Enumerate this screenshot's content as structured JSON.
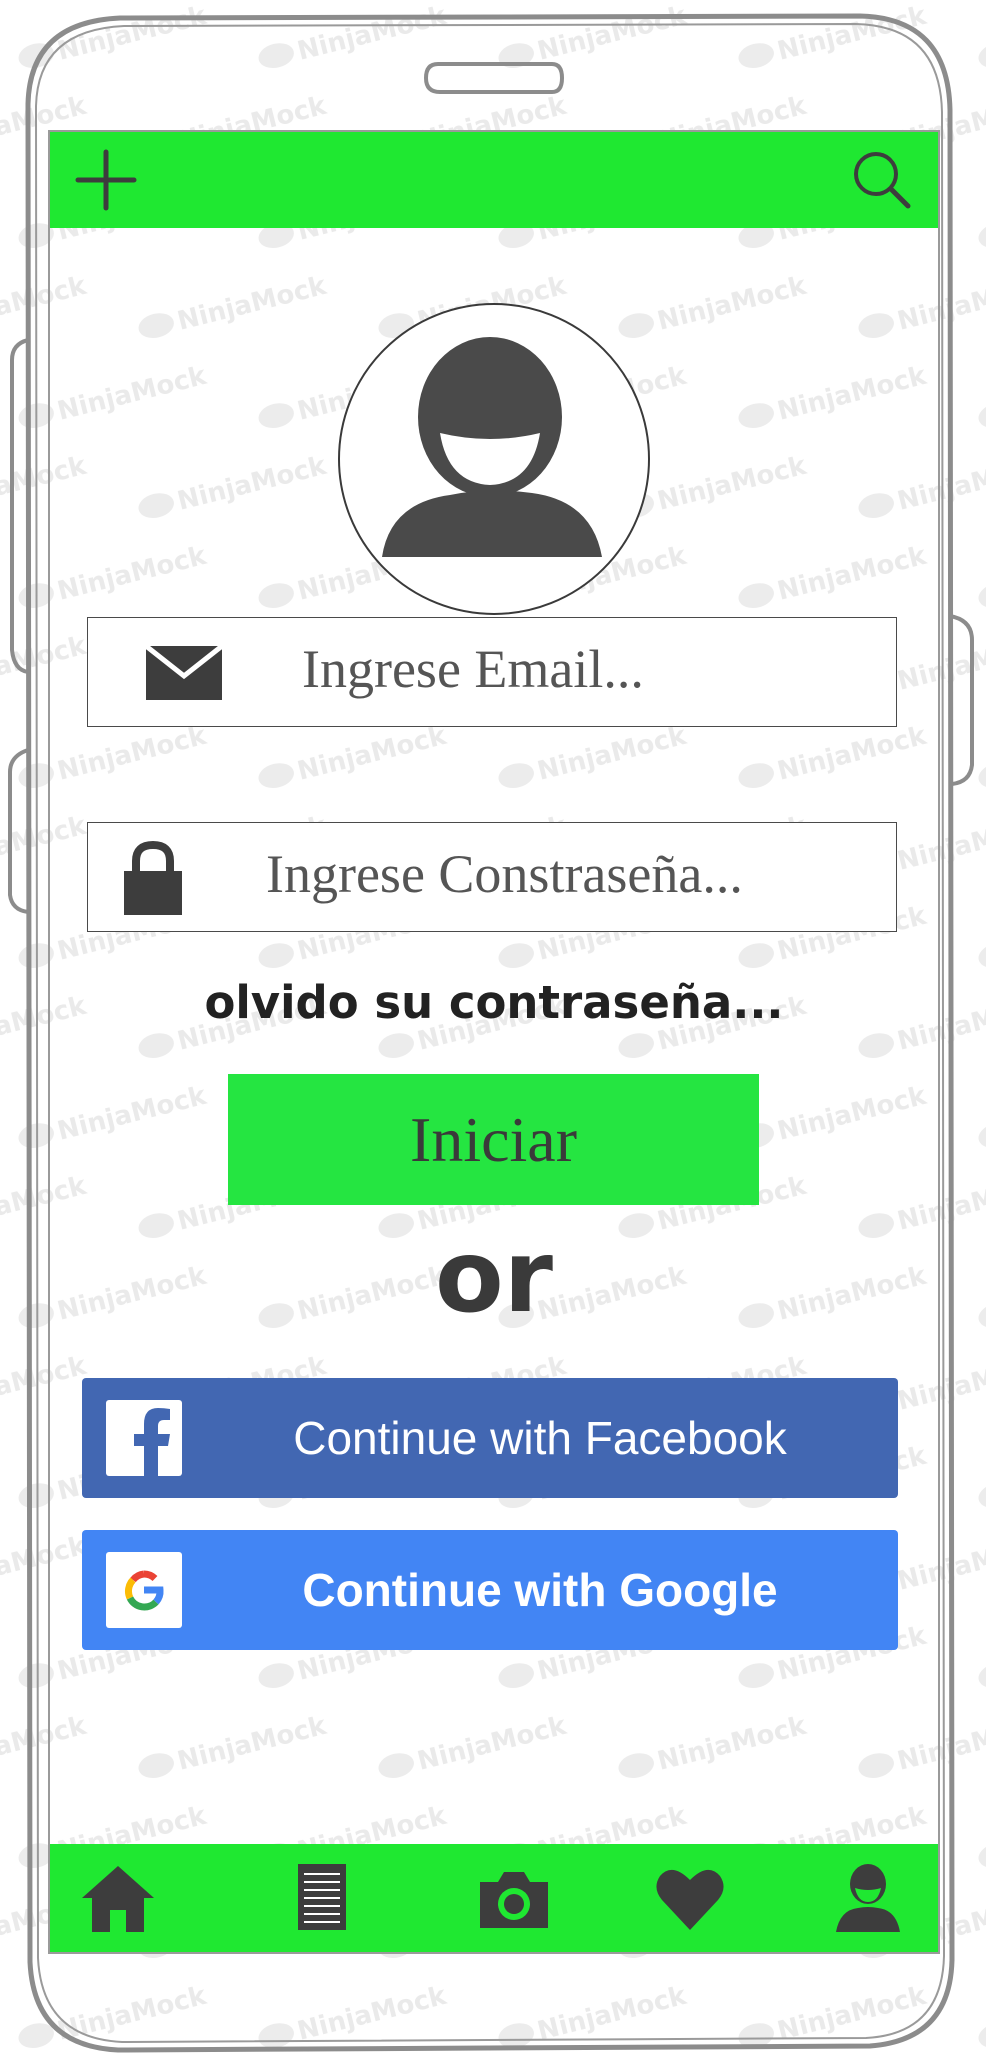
{
  "brand": {
    "watermark_text": "NinjaMock",
    "bar_color": "#1fe831",
    "button_color": "#25e541",
    "icon_color": "#3d3d3d",
    "facebook_color": "#4267b2",
    "google_color": "#4285f4"
  },
  "topbar": {
    "left_icon": "plus-icon",
    "right_icon": "search-icon"
  },
  "profile": {
    "avatar_icon": "user-avatar-icon"
  },
  "form": {
    "email_placeholder": "Ingrese Email...",
    "email_icon": "envelope-icon",
    "password_placeholder": "Ingrese Constraseña...",
    "password_icon": "lock-icon",
    "forgot_label": "olvido su contraseña...",
    "login_label": "Iniciar"
  },
  "divider": {
    "or_label": "or"
  },
  "social": {
    "facebook_label": "Continue with Facebook",
    "facebook_icon": "facebook-icon",
    "google_label": "Continue with Google",
    "google_icon": "google-icon"
  },
  "bottombar": {
    "items": [
      {
        "icon": "home-icon"
      },
      {
        "icon": "document-icon"
      },
      {
        "icon": "camera-icon"
      },
      {
        "icon": "heart-icon"
      },
      {
        "icon": "profile-icon"
      }
    ]
  }
}
